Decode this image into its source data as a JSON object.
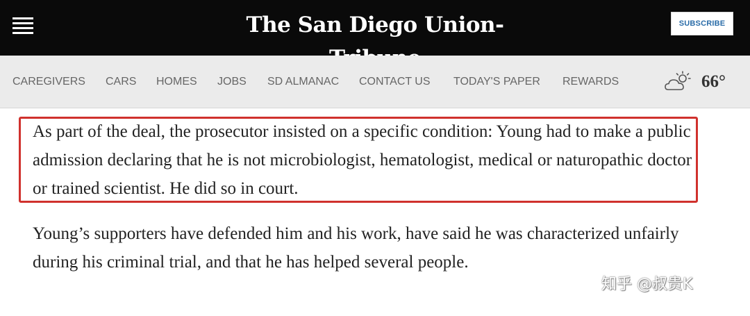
{
  "header": {
    "logo_text": "The San Diego Union-Tribune",
    "subscribe_label": "SUBSCRIBE",
    "menu_icon": "hamburger-menu-icon"
  },
  "nav": {
    "items": [
      {
        "label": "CAREGIVERS"
      },
      {
        "label": "CARS"
      },
      {
        "label": "HOMES"
      },
      {
        "label": "JOBS"
      },
      {
        "label": "SD ALMANAC"
      },
      {
        "label": "CONTACT US"
      },
      {
        "label": "TODAY'S PAPER"
      },
      {
        "label": "REWARDS"
      }
    ],
    "weather_icon": "partly-cloudy-icon",
    "temperature": "66°"
  },
  "article": {
    "paragraphs": [
      "As part of the deal, the prosecutor insisted on a specific condition: Young had to make a public admission declaring that he is not microbiologist, hematologist, medical or naturopathic doctor or trained scientist. He did so in court.",
      "Young’s supporters have defended him and his work, have said he was characterized unfairly during his criminal trial, and that he has helped several people."
    ],
    "highlight_color": "#d0312d"
  },
  "watermark": {
    "text": "知乎 @叔贵K"
  }
}
